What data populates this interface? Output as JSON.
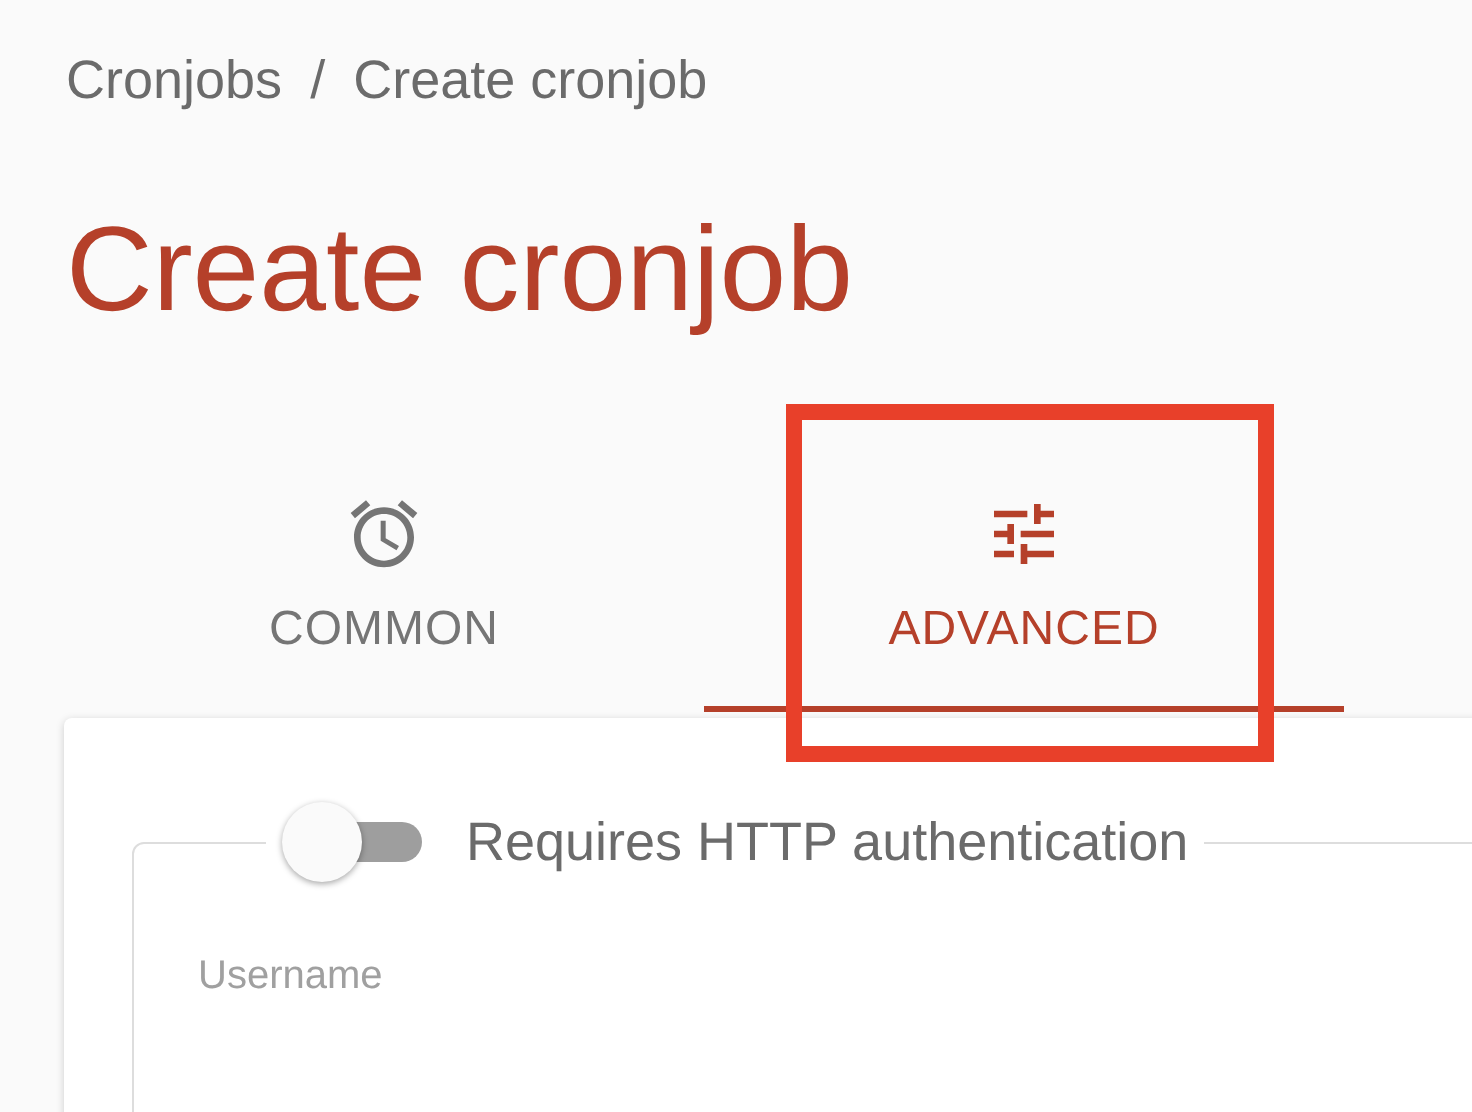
{
  "breadcrumb": [
    {
      "label": "Cronjobs"
    },
    {
      "label": "Create cronjob"
    }
  ],
  "breadcrumb_separator": "/",
  "title": "Create cronjob",
  "tabs": [
    {
      "label": "COMMON",
      "selected": false
    },
    {
      "label": "ADVANCED",
      "selected": true
    }
  ],
  "auth_section": {
    "toggle": {
      "label": "Requires HTTP authentication",
      "on": false
    },
    "fields": [
      {
        "label": "Username"
      }
    ]
  }
}
